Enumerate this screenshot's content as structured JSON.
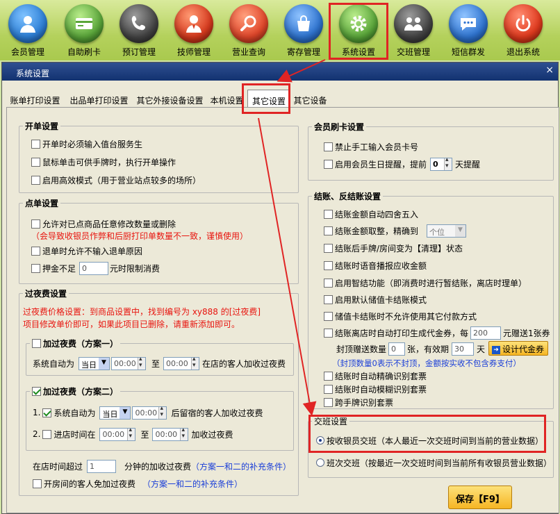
{
  "toolbar": {
    "items": [
      {
        "label": "会员管理",
        "icon": "member-icon",
        "color": "#2d7fd6"
      },
      {
        "label": "自助刷卡",
        "icon": "card-icon",
        "color": "#5aa63a"
      },
      {
        "label": "预订管理",
        "icon": "phone-icon",
        "color": "#4a4a4a"
      },
      {
        "label": "技师管理",
        "icon": "technician-icon",
        "color": "#d63a1e"
      },
      {
        "label": "营业查询",
        "icon": "search-icon",
        "color": "#e0462a"
      },
      {
        "label": "寄存管理",
        "icon": "bag-icon",
        "color": "#2f74d0"
      },
      {
        "label": "系统设置",
        "icon": "gear-icon",
        "color": "#5aa63a"
      },
      {
        "label": "交班管理",
        "icon": "handover-icon",
        "color": "#4a4a4a"
      },
      {
        "label": "短信群发",
        "icon": "sms-icon",
        "color": "#2f74d0"
      },
      {
        "label": "退出系统",
        "icon": "power-icon",
        "color": "#e03a1e"
      }
    ]
  },
  "dialog": {
    "title": "系统设置",
    "close": "×",
    "tabs": [
      "账单打印设置",
      "出品单打印设置",
      "其它外接设备设置",
      "本机设置",
      "其它设置",
      "其它设备"
    ],
    "active_tab": "其它设置"
  },
  "open_bill": {
    "title": "开单设置",
    "items": [
      "开单时必须输入值台服务生",
      "鼠标单击可供手牌时，执行开单操作",
      "启用高效模式（用于营业站点较多的场所）"
    ]
  },
  "order": {
    "title": "点单设置",
    "allow_modify": "允许对已点商品任意修改数量或删除",
    "warning": "（会导致收银员作弊和后厨打印单数量不一致，谨慎使用）",
    "no_reason": "退单时允许不输入退单原因",
    "deposit_pre": "押金不足",
    "deposit_value": "0",
    "deposit_post": "元时限制消费"
  },
  "overnight": {
    "title": "过夜费设置",
    "note1": "过夜费价格设置：到商品设置中，找到编号为 xy888 的[过夜费]",
    "note2": "项目修改单价即可，如果此项目已删除，请重新添加即可。",
    "plan1": {
      "title": "加过夜费（方案一）",
      "label": "系统自动为",
      "day": "当日",
      "from": "00:00",
      "to_label": "至",
      "to": "00:00",
      "suffix": "在店的客人加收过夜费"
    },
    "plan2": {
      "title": "加过夜费（方案二）",
      "r1_num": "1.",
      "r1_label": "系统自动为",
      "r1_day": "当日",
      "r1_time": "00:00",
      "r1_suffix": "后留宿的客人加收过夜费",
      "r2_num": "2.",
      "r2_label": "进店时间在",
      "r2_from": "00:00",
      "r2_to_label": "至",
      "r2_to": "00:00",
      "r2_suffix": "加收过夜费"
    },
    "stay_pre": "在店时间超过",
    "stay_value": "1",
    "stay_post": "分钟的加收过夜费",
    "stay_note": "（方案一和二的补充条件）",
    "room_free": "开房间的客人免加过夜费",
    "room_note": "（方案一和二的补充条件）"
  },
  "card": {
    "title": "会员刷卡设置",
    "no_manual": "禁止手工输入会员卡号",
    "birthday_pre": "启用会员生日提醒，提前",
    "birthday_value": "0",
    "birthday_post": "天提醒"
  },
  "checkout": {
    "title": "结账、反结账设置",
    "round": "结账金额自动四舍五入",
    "trunc": "结账金额取整，精确到",
    "trunc_option": "个位",
    "clean": "结账后手牌/房间变为【清理】状态",
    "voice": "结账时语音播报应收金额",
    "smart": "启用智结功能（即消费时进行暂结账，离店时理单）",
    "default_card": "启用默认储值卡结账模式",
    "no_other": "储值卡结账时不允许使用其它付款方式",
    "coupon_pre": "结账离店时自动打印生成代金券，每",
    "coupon_each": "200",
    "coupon_post": "元赠送1张券",
    "cap_pre": "封顶赠送数量",
    "cap_value": "0",
    "cap_mid": "张，有效期",
    "valid_value": "30",
    "valid_post": "天",
    "design_button": "设计代金券",
    "cap_note": "（封顶数量0表示不封顶，金额按实收不包含券支付）",
    "precise_ticket": "结账时自动精确识别套票",
    "fuzzy_ticket": "结账时自动模糊识别套票",
    "cross_ticket": "跨手牌识别套票"
  },
  "shift": {
    "title": "交班设置",
    "by_cashier": "按收银员交班（本人最近一次交班时间到当前的营业数据）",
    "by_shift": "班次交班（按最近一次交班时间到当前所有收银员营业数据）"
  },
  "save_button": "保存【F9】",
  "colors": {
    "highlight": "#e02424",
    "title_bar": "#1a3a7d",
    "dialog_bg": "#ece9d8",
    "warning_text": "#e8140e",
    "note_text": "#1a3ed8"
  }
}
